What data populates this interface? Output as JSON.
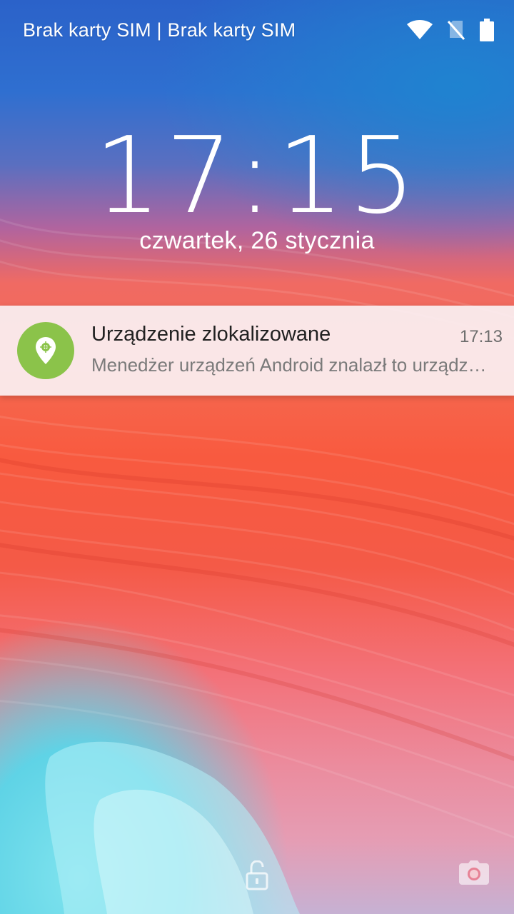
{
  "status_bar": {
    "carrier": "Brak karty SIM | Brak karty SIM",
    "icons": [
      "wifi-icon",
      "no-sim-icon",
      "battery-icon"
    ]
  },
  "lockscreen": {
    "time": "17:15",
    "date": "czwartek, 26 stycznia"
  },
  "notification": {
    "icon": "location-pin-icon",
    "icon_color": "#8bc34a",
    "title": "Urządzenie zlokalizowane",
    "time": "17:13",
    "text": "Menedżer urządzeń Android znalazł to urządzenie"
  },
  "shortcuts": {
    "center": "unlock-icon",
    "right": "camera-icon"
  }
}
